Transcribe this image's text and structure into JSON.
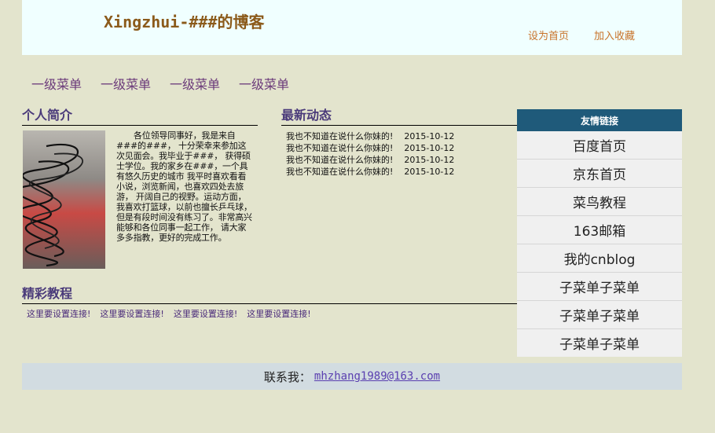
{
  "header": {
    "title": "Xingzhui-###的博客",
    "set_home": "设为首页",
    "add_favorite": "加入收藏"
  },
  "menu": [
    "一级菜单",
    "一级菜单",
    "一级菜单",
    "一级菜单"
  ],
  "profile": {
    "title": "个人简介",
    "text": "各位领导同事好，我是来自###的###， 十分荣幸来参加这次见面会。我毕业于###， 获得硕士学位。我的家乡在###，一个具有悠久历史的城市 我平时喜欢看看小说，浏览新闻，也喜欢四处去旅游， 开阔自己的视野。运动方面，我喜欢打篮球，以前也擅长乒乓球， 但是有段时间没有练习了。非常高兴能够和各位同事一起工作， 请大家多多指教，更好的完成工作。"
  },
  "news": {
    "title": "最新动态",
    "items": [
      {
        "text": "我也不知道在说什么你妹的!",
        "date": "2015-10-12"
      },
      {
        "text": "我也不知道在说什么你妹的!",
        "date": "2015-10-12"
      },
      {
        "text": "我也不知道在说什么你妹的!",
        "date": "2015-10-12"
      },
      {
        "text": "我也不知道在说什么你妹的!",
        "date": "2015-10-12"
      }
    ]
  },
  "tutorials": {
    "title": "精彩教程",
    "links": [
      "这里要设置连接!",
      "这里要设置连接!",
      "这里要设置连接!",
      "这里要设置连接!"
    ]
  },
  "friends": {
    "title": "友情链接",
    "items": [
      "百度首页",
      "京东首页",
      "菜鸟教程",
      "163邮箱",
      "我的cnblog",
      "子菜单子菜单",
      "子菜单子菜单",
      "子菜单子菜单"
    ]
  },
  "footer": {
    "label": "联系我：",
    "email": "mhzhang1989@163.com"
  }
}
